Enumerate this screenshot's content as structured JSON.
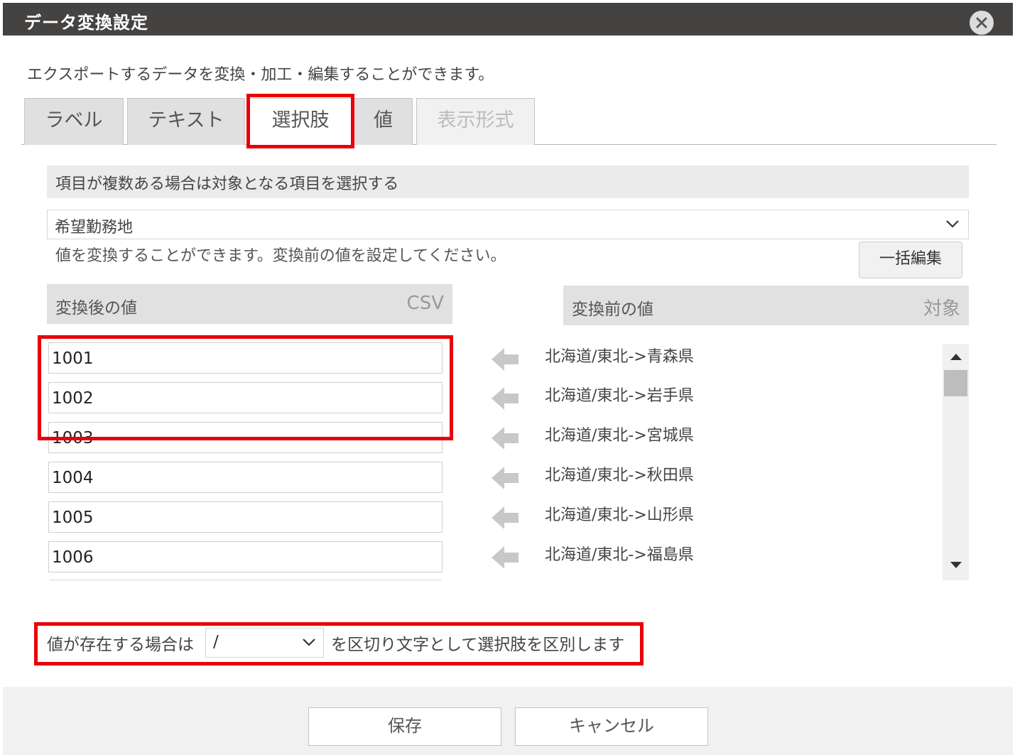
{
  "dialog": {
    "title": "データ変換設定",
    "close_icon": "close-icon"
  },
  "description": "エクスポートするデータを変換・加工・編集することができます。",
  "tabs": [
    {
      "label": "ラベル",
      "state": "normal"
    },
    {
      "label": "テキスト",
      "state": "normal"
    },
    {
      "label": "選択肢",
      "state": "active"
    },
    {
      "label": "値",
      "state": "normal"
    },
    {
      "label": "表示形式",
      "state": "disabled"
    }
  ],
  "item_section": {
    "heading": "項目が複数ある場合は対象となる項目を選択する",
    "selected_item": "希望勤務地"
  },
  "value_section": {
    "hint": "値を変換することができます。変換前の値を設定してください。",
    "bulk_edit_label": "一括編集",
    "after_header": "変換後の値",
    "after_header_tag": "CSV",
    "before_header": "変換前の値",
    "before_header_tag": "対象",
    "rows": [
      {
        "after": "1001",
        "before": "北海道/東北->青森県"
      },
      {
        "after": "1002",
        "before": "北海道/東北->岩手県"
      },
      {
        "after": "1003",
        "before": "北海道/東北->宮城県"
      },
      {
        "after": "1004",
        "before": "北海道/東北->秋田県"
      },
      {
        "after": "1005",
        "before": "北海道/東北->山形県"
      },
      {
        "after": "1006",
        "before": "北海道/東北->福島県"
      }
    ]
  },
  "separator": {
    "prefix": "値が存在する場合は",
    "value": "/",
    "suffix": "を区切り文字として選択肢を区別します"
  },
  "footer": {
    "save_label": "保存",
    "cancel_label": "キャンセル"
  },
  "colors": {
    "titlebar": "#454342",
    "highlight": "#e8000b",
    "header_bg": "#e1e1e1"
  }
}
